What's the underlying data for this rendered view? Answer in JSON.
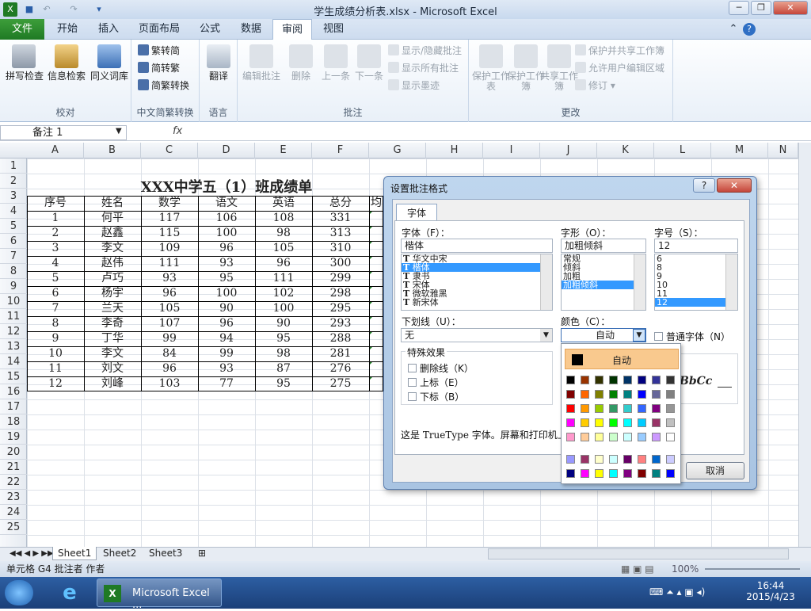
{
  "window": {
    "title": "学生成绩分析表.xlsx - Microsoft Excel"
  },
  "ribbon": {
    "file_tab": "文件",
    "tabs": [
      "开始",
      "插入",
      "页面布局",
      "公式",
      "数据",
      "审阅",
      "视图"
    ],
    "active_tab": "审阅",
    "groups": {
      "proofing": {
        "title": "校对",
        "buttons": [
          "拼写检查",
          "信息检索",
          "同义词库"
        ]
      },
      "chinese": {
        "title": "中文简繁转换",
        "buttons": [
          "繁转简",
          "简转繁",
          "简繁转换"
        ]
      },
      "language": {
        "title": "语言",
        "buttons": [
          "翻译"
        ]
      },
      "comments": {
        "title": "批注",
        "buttons": [
          "编辑批注",
          "删除",
          "上一条",
          "下一条"
        ],
        "small": [
          "显示/隐藏批注",
          "显示所有批注",
          "显示墨迹"
        ]
      },
      "changes": {
        "title": "更改",
        "buttons": [
          "保护工作表",
          "保护工作簿",
          "共享工作簿"
        ],
        "small": [
          "保护并共享工作簿",
          "允许用户编辑区域",
          "修订"
        ]
      }
    }
  },
  "formula": {
    "namebox": "备注 1",
    "fx": "fx"
  },
  "sheet": {
    "columns": [
      "A",
      "B",
      "C",
      "D",
      "E",
      "F",
      "G",
      "H",
      "I",
      "J",
      "K",
      "L",
      "M",
      "N"
    ],
    "rows": [
      "1",
      "2",
      "3",
      "4",
      "5",
      "6",
      "7",
      "8",
      "9",
      "10",
      "11",
      "12",
      "13",
      "14",
      "15",
      "16",
      "17",
      "18",
      "19",
      "20",
      "21",
      "22",
      "23",
      "24",
      "25"
    ],
    "title": "XXX中学五（1）班成绩单",
    "headers": [
      "序号",
      "姓名",
      "数学",
      "语文",
      "英语",
      "总分",
      "均"
    ],
    "data": [
      [
        "1",
        "何平",
        "117",
        "106",
        "108",
        "331"
      ],
      [
        "2",
        "赵鑫",
        "115",
        "100",
        "98",
        "313"
      ],
      [
        "3",
        "李文",
        "109",
        "96",
        "105",
        "310"
      ],
      [
        "4",
        "赵伟",
        "111",
        "93",
        "96",
        "300"
      ],
      [
        "5",
        "卢巧",
        "93",
        "95",
        "111",
        "299"
      ],
      [
        "6",
        "杨宇",
        "96",
        "100",
        "102",
        "298"
      ],
      [
        "7",
        "兰天",
        "105",
        "90",
        "100",
        "295"
      ],
      [
        "8",
        "李奇",
        "107",
        "96",
        "90",
        "293"
      ],
      [
        "9",
        "丁华",
        "99",
        "94",
        "95",
        "288"
      ],
      [
        "10",
        "李文",
        "84",
        "99",
        "98",
        "281"
      ],
      [
        "11",
        "刘文",
        "96",
        "93",
        "87",
        "276"
      ],
      [
        "12",
        "刘峰",
        "103",
        "77",
        "95",
        "275"
      ]
    ],
    "tabs": [
      "Sheet1",
      "Sheet2",
      "Sheet3"
    ]
  },
  "status": {
    "text": "单元格 G4 批注者 作者",
    "zoom": "100%"
  },
  "taskbar": {
    "app": "Microsoft Excel ...",
    "time": "16:44",
    "date": "2015/4/23"
  },
  "dialog": {
    "title": "设置批注格式",
    "tab": "字体",
    "font_label": "字体（F）：",
    "font_value": "楷体",
    "font_list": [
      "华文中宋",
      "楷体",
      "隶书",
      "宋体",
      "微软雅黑",
      "新宋体"
    ],
    "font_selected": 1,
    "style_label": "字形（O）：",
    "style_value": "加粗倾斜",
    "style_list": [
      "常规",
      "倾斜",
      "加粗",
      "加粗倾斜"
    ],
    "style_selected": 3,
    "size_label": "字号（S）：",
    "size_value": "12",
    "size_list": [
      "6",
      "8",
      "9",
      "10",
      "11",
      "12"
    ],
    "size_selected": 5,
    "underline_label": "下划线（U）：",
    "underline_value": "无",
    "color_label": "颜色（C）：",
    "color_value": "自动",
    "normal_font": "普通字体（N）",
    "effects_label": "特殊效果",
    "effects": [
      "删除线（K）",
      "上标（E）",
      "下标（B）"
    ],
    "preview": "BbCc",
    "info": "这是 TrueType 字体。屏幕和打印机上",
    "cancel": "取消",
    "auto": "自动"
  },
  "palette": {
    "rows": [
      [
        "#000000",
        "#993300",
        "#333300",
        "#003300",
        "#003366",
        "#000080",
        "#333399",
        "#333333"
      ],
      [
        "#800000",
        "#ff6600",
        "#808000",
        "#008000",
        "#008080",
        "#0000ff",
        "#666699",
        "#808080"
      ],
      [
        "#ff0000",
        "#ff9900",
        "#99cc00",
        "#339966",
        "#33cccc",
        "#3366ff",
        "#800080",
        "#969696"
      ],
      [
        "#ff00ff",
        "#ffcc00",
        "#ffff00",
        "#00ff00",
        "#00ffff",
        "#00ccff",
        "#993366",
        "#c0c0c0"
      ],
      [
        "#ff99cc",
        "#ffcc99",
        "#ffff99",
        "#ccffcc",
        "#ccffff",
        "#99ccff",
        "#cc99ff",
        "#ffffff"
      ],
      [
        "#9999ff",
        "#993366",
        "#ffffcc",
        "#ccffff",
        "#660066",
        "#ff8080",
        "#0066cc",
        "#ccccff"
      ],
      [
        "#000080",
        "#ff00ff",
        "#ffff00",
        "#00ffff",
        "#800080",
        "#800000",
        "#008080",
        "#0000ff"
      ]
    ]
  }
}
